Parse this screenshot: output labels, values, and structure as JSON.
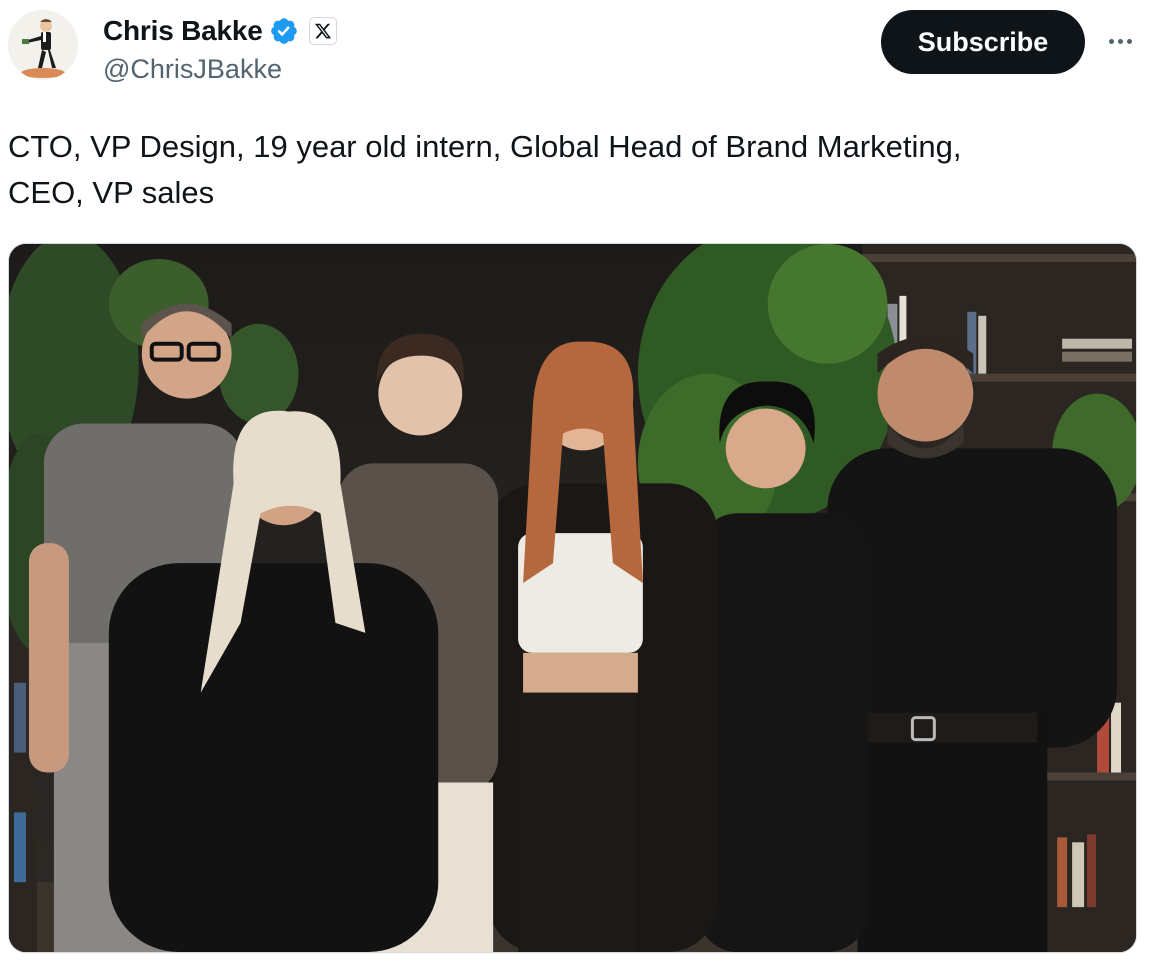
{
  "author": {
    "display_name": "Chris Bakke",
    "handle": "@ChrisJBakke",
    "avatar_icon": "avatar-cartoon-figure",
    "verified_icon": "verified-badge-icon",
    "verified_color": "#1d9bf0",
    "affiliation_icon": "x-logo-icon"
  },
  "actions": {
    "subscribe_label": "Subscribe",
    "more_icon": "more-horizontal-icon"
  },
  "tweet": {
    "text": "CTO, VP Design, 19 year old intern, Global Head of Brand Marketing,\nCEO, VP sales"
  },
  "media": {
    "type": "photo",
    "alt": "",
    "people_count": 6
  },
  "colors": {
    "text_primary": "#0f1419",
    "text_secondary": "#536471",
    "button_bg": "#0f1419",
    "border": "#cfd9de"
  }
}
